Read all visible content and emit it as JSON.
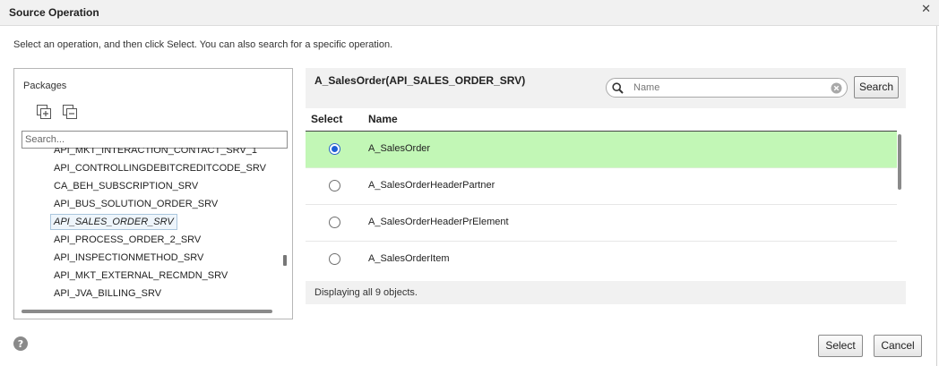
{
  "dialog": {
    "title": "Source Operation",
    "instructions": "Select an operation, and then click Select. You can also search for a specific operation."
  },
  "packages": {
    "label": "Packages",
    "search_placeholder": "Search...",
    "items": [
      {
        "label": "API_MKT_INTERACTION_CONTACT_SRV_1"
      },
      {
        "label": "API_CONTROLLINGDEBITCREDITCODE_SRV"
      },
      {
        "label": "CA_BEH_SUBSCRIPTION_SRV"
      },
      {
        "label": "API_BUS_SOLUTION_ORDER_SRV"
      },
      {
        "label": "API_SALES_ORDER_SRV",
        "selected": true
      },
      {
        "label": "API_PROCESS_ORDER_2_SRV"
      },
      {
        "label": "API_INSPECTIONMETHOD_SRV"
      },
      {
        "label": "API_MKT_EXTERNAL_RECMDN_SRV"
      },
      {
        "label": "API_JVA_BILLING_SRV"
      }
    ]
  },
  "operations": {
    "title": "A_SalesOrder(API_SALES_ORDER_SRV)",
    "search_placeholder": "Name",
    "search_button": "Search",
    "columns": {
      "select": "Select",
      "name": "Name"
    },
    "rows": [
      {
        "name": "A_SalesOrder",
        "selected": true
      },
      {
        "name": "A_SalesOrderHeaderPartner",
        "selected": false
      },
      {
        "name": "A_SalesOrderHeaderPrElement",
        "selected": false
      },
      {
        "name": "A_SalesOrderItem",
        "selected": false
      }
    ],
    "status": "Displaying all 9 objects."
  },
  "footer": {
    "select_button": "Select",
    "cancel_button": "Cancel"
  },
  "colors": {
    "selected_row": "#c2f7b6",
    "radio_checked": "#1e5fd6",
    "header_bg": "#f1f1f1"
  }
}
